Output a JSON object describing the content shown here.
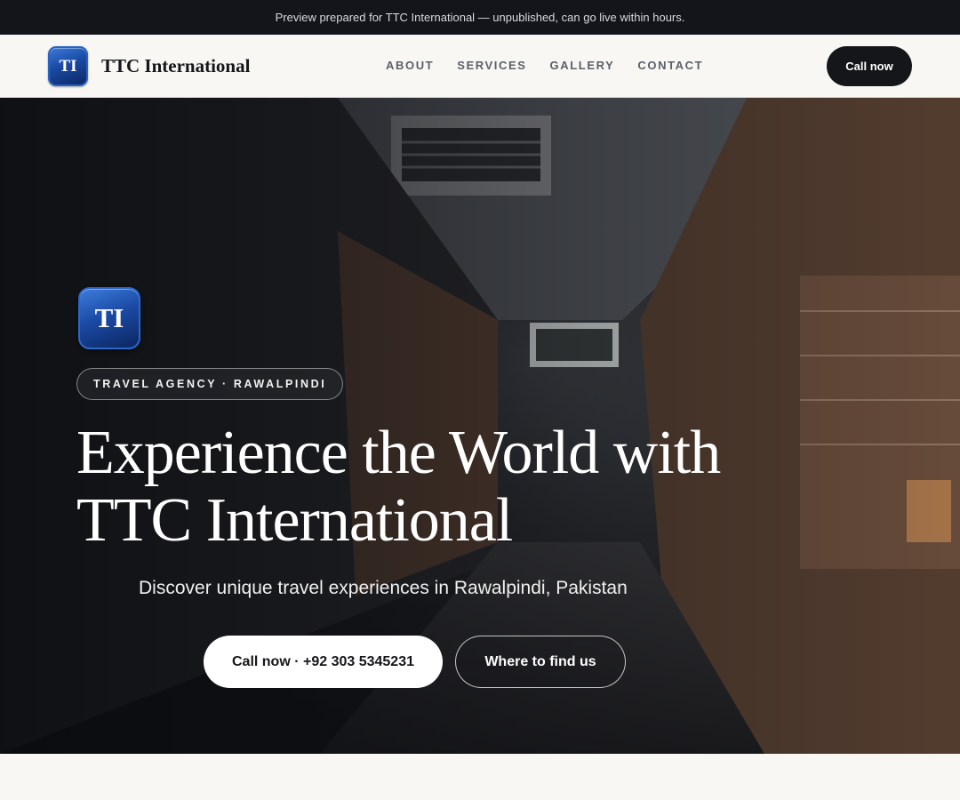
{
  "banner": {
    "text": "Preview prepared for TTC International — unpublished, can go live within hours."
  },
  "nav": {
    "logo_initials": "TI",
    "brand_name": "TTC International",
    "links": [
      {
        "label": "ABOUT"
      },
      {
        "label": "SERVICES"
      },
      {
        "label": "GALLERY"
      },
      {
        "label": "CONTACT"
      }
    ],
    "cta_label": "Call now"
  },
  "hero": {
    "logo_initials": "TI",
    "tag": "TRAVEL AGENCY · RAWALPINDI",
    "headline_line1": "Experience the World with",
    "headline_line2": "TTC International",
    "subtitle": "Discover unique travel experiences in Rawalpindi, Pakistan",
    "primary_button": "Call now · +92 303 5345231",
    "secondary_button": "Where to find us",
    "background_description_icon": "market-alley-photo"
  },
  "colors": {
    "dark": "#15161a",
    "page_bg": "#f8f7f3",
    "logo_blue": "#1a4aa3",
    "banner_bg": "#13151b"
  }
}
